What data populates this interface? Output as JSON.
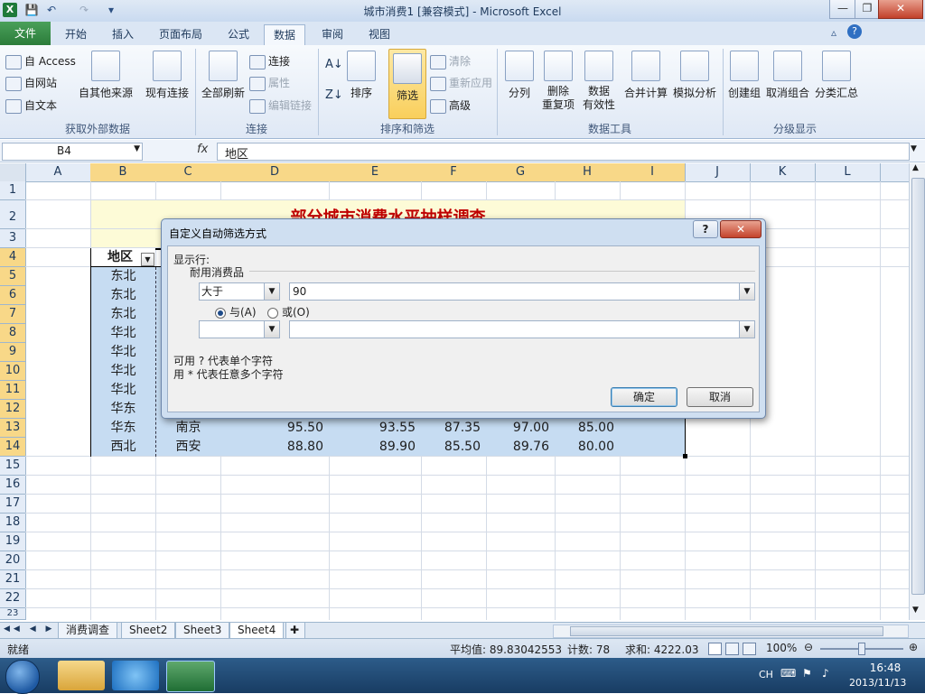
{
  "window": {
    "title": "城市消费1 [兼容模式] - Microsoft Excel",
    "app_icon": "X",
    "qat": {
      "save": "💾",
      "undo": "↶",
      "redo": "↷",
      "customize": "▾"
    },
    "controls": {
      "minimize": "—",
      "restore": "❐",
      "close": "✕"
    }
  },
  "ribbon": {
    "tabs": [
      {
        "label": "文件"
      },
      {
        "label": "开始"
      },
      {
        "label": "插入"
      },
      {
        "label": "页面布局"
      },
      {
        "label": "公式"
      },
      {
        "label": "数据"
      },
      {
        "label": "审阅"
      },
      {
        "label": "视图"
      }
    ],
    "active_tab": "数据",
    "groups": {
      "external": {
        "label": "获取外部数据",
        "from_access": "自 Access",
        "from_web": "自网站",
        "from_text": "自文本",
        "other_sources": "自其他来源",
        "existing": "现有连接"
      },
      "connections": {
        "label": "连接",
        "refresh_all": "全部刷新",
        "connections": "连接",
        "properties": "属性",
        "edit_links": "编辑链接"
      },
      "sort_filter": {
        "label": "排序和筛选",
        "sort": "排序",
        "filter": "筛选",
        "clear": "清除",
        "reapply": "重新应用",
        "advanced": "高级"
      },
      "data_tools": {
        "label": "数据工具",
        "text_to_columns": "分列",
        "remove_dup_1": "删除",
        "remove_dup_2": "重复项",
        "validation_1": "数据",
        "validation_2": "有效性",
        "consolidate": "合并计算",
        "whatif": "模拟分析"
      },
      "outline": {
        "label": "分级显示",
        "group": "创建组",
        "ungroup": "取消组合",
        "subtotal": "分类汇总"
      }
    }
  },
  "formula_bar": {
    "name_box": "B4",
    "fx": "fx",
    "content": "地区"
  },
  "sheet": {
    "columns": [
      "A",
      "B",
      "C",
      "D",
      "E",
      "F",
      "G",
      "H",
      "I",
      "J",
      "K",
      "L"
    ],
    "rows": [
      "1",
      "2",
      "3",
      "4",
      "5",
      "6",
      "7",
      "8",
      "9",
      "10",
      "11",
      "12",
      "13",
      "14",
      "15",
      "16",
      "17",
      "18",
      "19",
      "20",
      "21",
      "22",
      "23"
    ],
    "title_text": "部分城市消费水平抽样调查",
    "header_b4": "地区",
    "region_col": [
      "东北",
      "东北",
      "东北",
      "华北",
      "华北",
      "华北",
      "华北",
      "华东",
      "华东",
      "西北"
    ],
    "row13": {
      "city": "南京",
      "d": "95.50",
      "e": "93.55",
      "f": "87.35",
      "g": "97.00",
      "h": "85.00"
    },
    "row14": {
      "city": "西安",
      "d": "88.80",
      "e": "89.90",
      "f": "85.50",
      "g": "89.76",
      "h": "80.00"
    }
  },
  "sheet_tabs": [
    {
      "label": "消费调查"
    },
    {
      "label": "Sheet2"
    },
    {
      "label": "Sheet3"
    },
    {
      "label": "Sheet4"
    }
  ],
  "status": {
    "ready": "就绪",
    "average": "平均值: 89.83042553",
    "count": "计数: 78",
    "sum": "求和: 4222.03",
    "zoom": "100%"
  },
  "taskbar": {
    "lang": "CH",
    "time": "16:48",
    "date": "2013/11/13"
  },
  "dialog": {
    "title": "自定义自动筛选方式",
    "help": "?",
    "close": "✕",
    "show_rows": "显示行:",
    "field": "耐用消费品",
    "op1": "大于",
    "val1": "90",
    "and_label": "与(A)",
    "or_label": "或(O)",
    "op2": "",
    "val2": "",
    "hint1": "可用 ? 代表单个字符",
    "hint2": "用 * 代表任意多个字符",
    "ok": "确定",
    "cancel": "取消"
  }
}
